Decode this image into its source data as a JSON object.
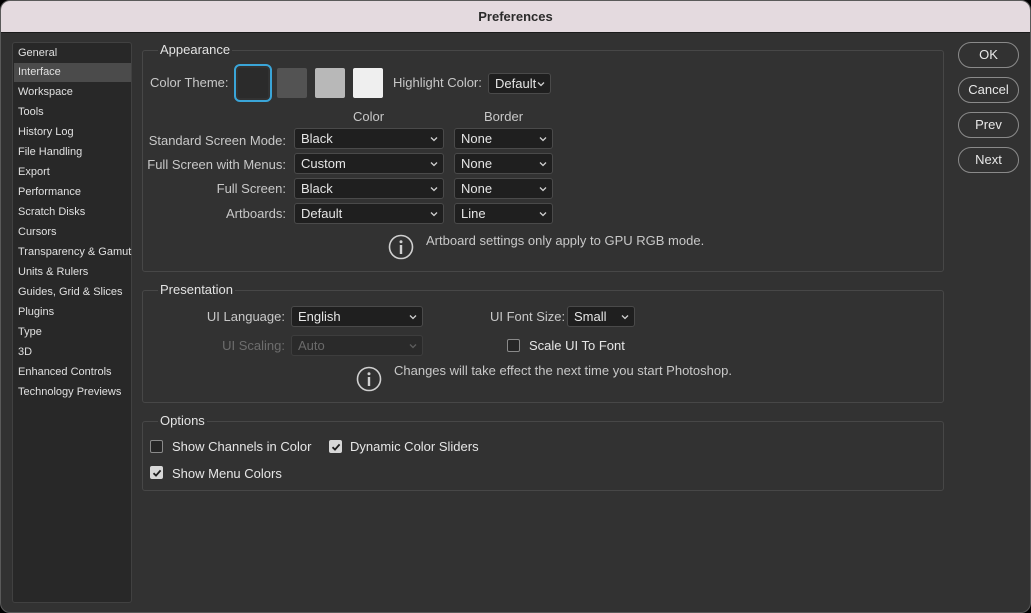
{
  "window": {
    "title": "Preferences"
  },
  "sidebar": {
    "items": [
      {
        "label": "General"
      },
      {
        "label": "Interface",
        "selected": true
      },
      {
        "label": "Workspace"
      },
      {
        "label": "Tools"
      },
      {
        "label": "History Log"
      },
      {
        "label": "File Handling"
      },
      {
        "label": "Export"
      },
      {
        "label": "Performance"
      },
      {
        "label": "Scratch Disks"
      },
      {
        "label": "Cursors"
      },
      {
        "label": "Transparency & Gamut"
      },
      {
        "label": "Units & Rulers"
      },
      {
        "label": "Guides, Grid & Slices"
      },
      {
        "label": "Plugins"
      },
      {
        "label": "Type"
      },
      {
        "label": "3D"
      },
      {
        "label": "Enhanced Controls"
      },
      {
        "label": "Technology Previews"
      }
    ]
  },
  "appearance": {
    "title": "Appearance",
    "color_theme_label": "Color Theme:",
    "themes": [
      {
        "name": "darkest",
        "color": "#2b2b2b",
        "selected": true
      },
      {
        "name": "dark",
        "color": "#535353"
      },
      {
        "name": "light",
        "color": "#b8b8b8"
      },
      {
        "name": "lightest",
        "color": "#efefef"
      }
    ],
    "highlight_label": "Highlight Color:",
    "highlight_value": "Default",
    "col_color": "Color",
    "col_border": "Border",
    "rows": [
      {
        "label": "Standard Screen Mode:",
        "color": "Black",
        "border": "None"
      },
      {
        "label": "Full Screen with Menus:",
        "color": "Custom",
        "border": "None"
      },
      {
        "label": "Full Screen:",
        "color": "Black",
        "border": "None"
      },
      {
        "label": "Artboards:",
        "color": "Default",
        "border": "Line"
      }
    ],
    "note": "Artboard settings only apply to GPU RGB mode."
  },
  "presentation": {
    "title": "Presentation",
    "ui_language_label": "UI Language:",
    "ui_language_value": "English",
    "ui_font_size_label": "UI Font Size:",
    "ui_font_size_value": "Small",
    "ui_scaling_label": "UI Scaling:",
    "ui_scaling_value": "Auto",
    "scale_ui_label": "Scale UI To Font",
    "scale_ui_checked": false,
    "note": "Changes will take effect the next time you start Photoshop."
  },
  "options": {
    "title": "Options",
    "show_channels_label": "Show Channels in Color",
    "show_channels_checked": false,
    "dynamic_sliders_label": "Dynamic Color Sliders",
    "dynamic_sliders_checked": true,
    "show_menu_colors_label": "Show Menu Colors",
    "show_menu_colors_checked": true
  },
  "buttons": {
    "ok": "OK",
    "cancel": "Cancel",
    "prev": "Prev",
    "next": "Next"
  },
  "colors": {
    "accent": "#3aa5d8",
    "window_bg": "#323232",
    "titlebar_bg": "#e4dadf"
  }
}
